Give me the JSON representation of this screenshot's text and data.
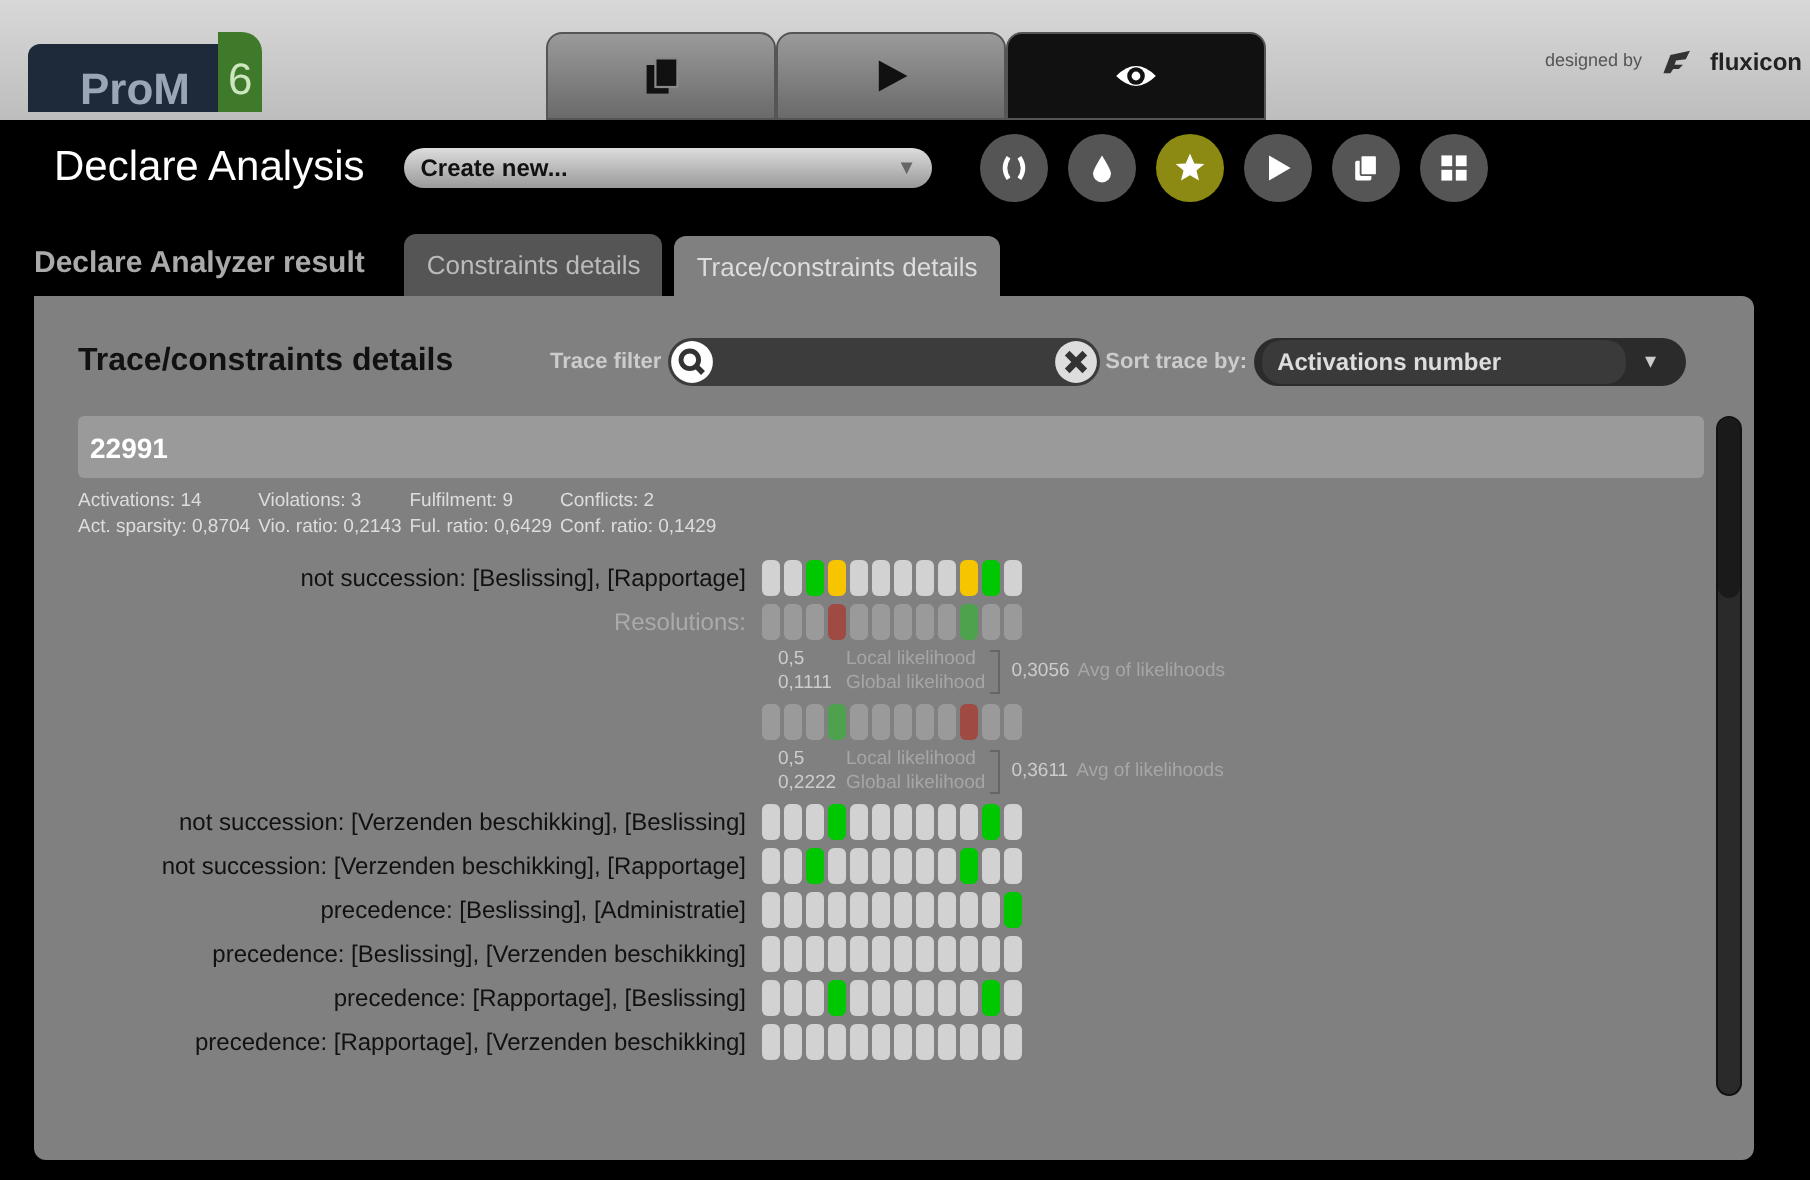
{
  "brand": {
    "name": "ProM",
    "version": "6",
    "credit": "designed by",
    "company": "fluxicon"
  },
  "view_tabs": [
    {
      "selected": false
    },
    {
      "selected": false
    },
    {
      "selected": true
    }
  ],
  "header": {
    "title": "Declare Analysis",
    "dropdown": "Create new...",
    "dropdown_caret": "▼"
  },
  "toolbar": [
    {
      "selected": false
    },
    {
      "selected": false
    },
    {
      "selected": true
    },
    {
      "selected": false
    },
    {
      "selected": false
    },
    {
      "selected": false
    }
  ],
  "result_title": "Declare Analyzer result",
  "tabs": [
    {
      "label": "Constraints details",
      "selected": false
    },
    {
      "label": "Trace/constraints details",
      "selected": true
    }
  ],
  "panel": {
    "title": "Trace/constraints details",
    "filter_label": "Trace filter",
    "sort_label": "Sort trace by:",
    "sort_value": "Activations number",
    "sort_caret": "▾"
  },
  "trace": {
    "id": "22991",
    "stats": [
      [
        "Activations: 14",
        "Act. sparsity: 0,8704"
      ],
      [
        "Violations: 3",
        "Vio. ratio: 0,2143"
      ],
      [
        "Fulfilment: 9",
        "Ful. ratio: 0,6429"
      ],
      [
        "Conflicts: 2",
        "Conf. ratio: 0,1429"
      ]
    ]
  },
  "constraints": [
    {
      "name": "not succession: [Beslissing], [Rapportage]",
      "cells": [
        {
          "color": "#d2d2d2"
        },
        {
          "color": "#d2d2d2"
        },
        {
          "color": "#00c800"
        },
        {
          "color": "#f7c400"
        },
        {
          "color": "#d2d2d2"
        },
        {
          "color": "#d2d2d2"
        },
        {
          "color": "#d2d2d2"
        },
        {
          "color": "#d2d2d2"
        },
        {
          "color": "#d2d2d2"
        },
        {
          "color": "#f7c400"
        },
        {
          "color": "#00c800"
        },
        {
          "color": "#d2d2d2"
        }
      ],
      "resolutions_label": "Resolutions:",
      "resolutions": [
        {
          "cells": [
            {
              "color": "#9a9a9a"
            },
            {
              "color": "#9a9a9a"
            },
            {
              "color": "#9a9a9a"
            },
            {
              "color": "#a04a44"
            },
            {
              "color": "#9a9a9a"
            },
            {
              "color": "#9a9a9a"
            },
            {
              "color": "#9a9a9a"
            },
            {
              "color": "#9a9a9a"
            },
            {
              "color": "#9a9a9a"
            },
            {
              "color": "#4ea24e"
            },
            {
              "color": "#9a9a9a"
            },
            {
              "color": "#9a9a9a"
            }
          ],
          "local": "0,5",
          "local_label": "Local likelihood",
          "global": "0,1111",
          "global_label": "Global likelihood",
          "avg": "0,3056",
          "avg_label": "Avg of likelihoods"
        },
        {
          "cells": [
            {
              "color": "#9a9a9a"
            },
            {
              "color": "#9a9a9a"
            },
            {
              "color": "#9a9a9a"
            },
            {
              "color": "#4ea24e"
            },
            {
              "color": "#9a9a9a"
            },
            {
              "color": "#9a9a9a"
            },
            {
              "color": "#9a9a9a"
            },
            {
              "color": "#9a9a9a"
            },
            {
              "color": "#9a9a9a"
            },
            {
              "color": "#a04a44"
            },
            {
              "color": "#9a9a9a"
            },
            {
              "color": "#9a9a9a"
            }
          ],
          "local": "0,5",
          "local_label": "Local likelihood",
          "global": "0,2222",
          "global_label": "Global likelihood",
          "avg": "0,3611",
          "avg_label": "Avg of likelihoods"
        }
      ]
    },
    {
      "name": "not succession: [Verzenden beschikking], [Beslissing]",
      "cells": [
        {
          "color": "#d2d2d2"
        },
        {
          "color": "#d2d2d2"
        },
        {
          "color": "#d2d2d2"
        },
        {
          "color": "#00c800"
        },
        {
          "color": "#d2d2d2"
        },
        {
          "color": "#d2d2d2"
        },
        {
          "color": "#d2d2d2"
        },
        {
          "color": "#d2d2d2"
        },
        {
          "color": "#d2d2d2"
        },
        {
          "color": "#d2d2d2"
        },
        {
          "color": "#00c800"
        },
        {
          "color": "#d2d2d2"
        }
      ]
    },
    {
      "name": "not succession: [Verzenden beschikking], [Rapportage]",
      "cells": [
        {
          "color": "#d2d2d2"
        },
        {
          "color": "#d2d2d2"
        },
        {
          "color": "#00c800"
        },
        {
          "color": "#d2d2d2"
        },
        {
          "color": "#d2d2d2"
        },
        {
          "color": "#d2d2d2"
        },
        {
          "color": "#d2d2d2"
        },
        {
          "color": "#d2d2d2"
        },
        {
          "color": "#d2d2d2"
        },
        {
          "color": "#00c800"
        },
        {
          "color": "#d2d2d2"
        },
        {
          "color": "#d2d2d2"
        }
      ]
    },
    {
      "name": "precedence: [Beslissing], [Administratie]",
      "cells": [
        {
          "color": "#d2d2d2"
        },
        {
          "color": "#d2d2d2"
        },
        {
          "color": "#d2d2d2"
        },
        {
          "color": "#d2d2d2"
        },
        {
          "color": "#d2d2d2"
        },
        {
          "color": "#d2d2d2"
        },
        {
          "color": "#d2d2d2"
        },
        {
          "color": "#d2d2d2"
        },
        {
          "color": "#d2d2d2"
        },
        {
          "color": "#d2d2d2"
        },
        {
          "color": "#d2d2d2"
        },
        {
          "color": "#00c800"
        }
      ]
    },
    {
      "name": "precedence: [Beslissing], [Verzenden beschikking]",
      "cells": [
        {
          "color": "#d2d2d2"
        },
        {
          "color": "#d2d2d2"
        },
        {
          "color": "#d2d2d2"
        },
        {
          "color": "#d2d2d2"
        },
        {
          "color": "#d2d2d2"
        },
        {
          "color": "#d2d2d2"
        },
        {
          "color": "#d2d2d2"
        },
        {
          "color": "#d2d2d2"
        },
        {
          "color": "#d2d2d2"
        },
        {
          "color": "#d2d2d2"
        },
        {
          "color": "#d2d2d2"
        },
        {
          "color": "#d2d2d2"
        }
      ]
    },
    {
      "name": "precedence: [Rapportage], [Beslissing]",
      "cells": [
        {
          "color": "#d2d2d2"
        },
        {
          "color": "#d2d2d2"
        },
        {
          "color": "#d2d2d2"
        },
        {
          "color": "#00c800"
        },
        {
          "color": "#d2d2d2"
        },
        {
          "color": "#d2d2d2"
        },
        {
          "color": "#d2d2d2"
        },
        {
          "color": "#d2d2d2"
        },
        {
          "color": "#d2d2d2"
        },
        {
          "color": "#d2d2d2"
        },
        {
          "color": "#00c800"
        },
        {
          "color": "#d2d2d2"
        }
      ]
    },
    {
      "name": "precedence: [Rapportage], [Verzenden beschikking]",
      "cells": [
        {
          "color": "#d2d2d2"
        },
        {
          "color": "#d2d2d2"
        },
        {
          "color": "#d2d2d2"
        },
        {
          "color": "#d2d2d2"
        },
        {
          "color": "#d2d2d2"
        },
        {
          "color": "#d2d2d2"
        },
        {
          "color": "#d2d2d2"
        },
        {
          "color": "#d2d2d2"
        },
        {
          "color": "#d2d2d2"
        },
        {
          "color": "#d2d2d2"
        },
        {
          "color": "#d2d2d2"
        },
        {
          "color": "#d2d2d2"
        }
      ]
    }
  ]
}
